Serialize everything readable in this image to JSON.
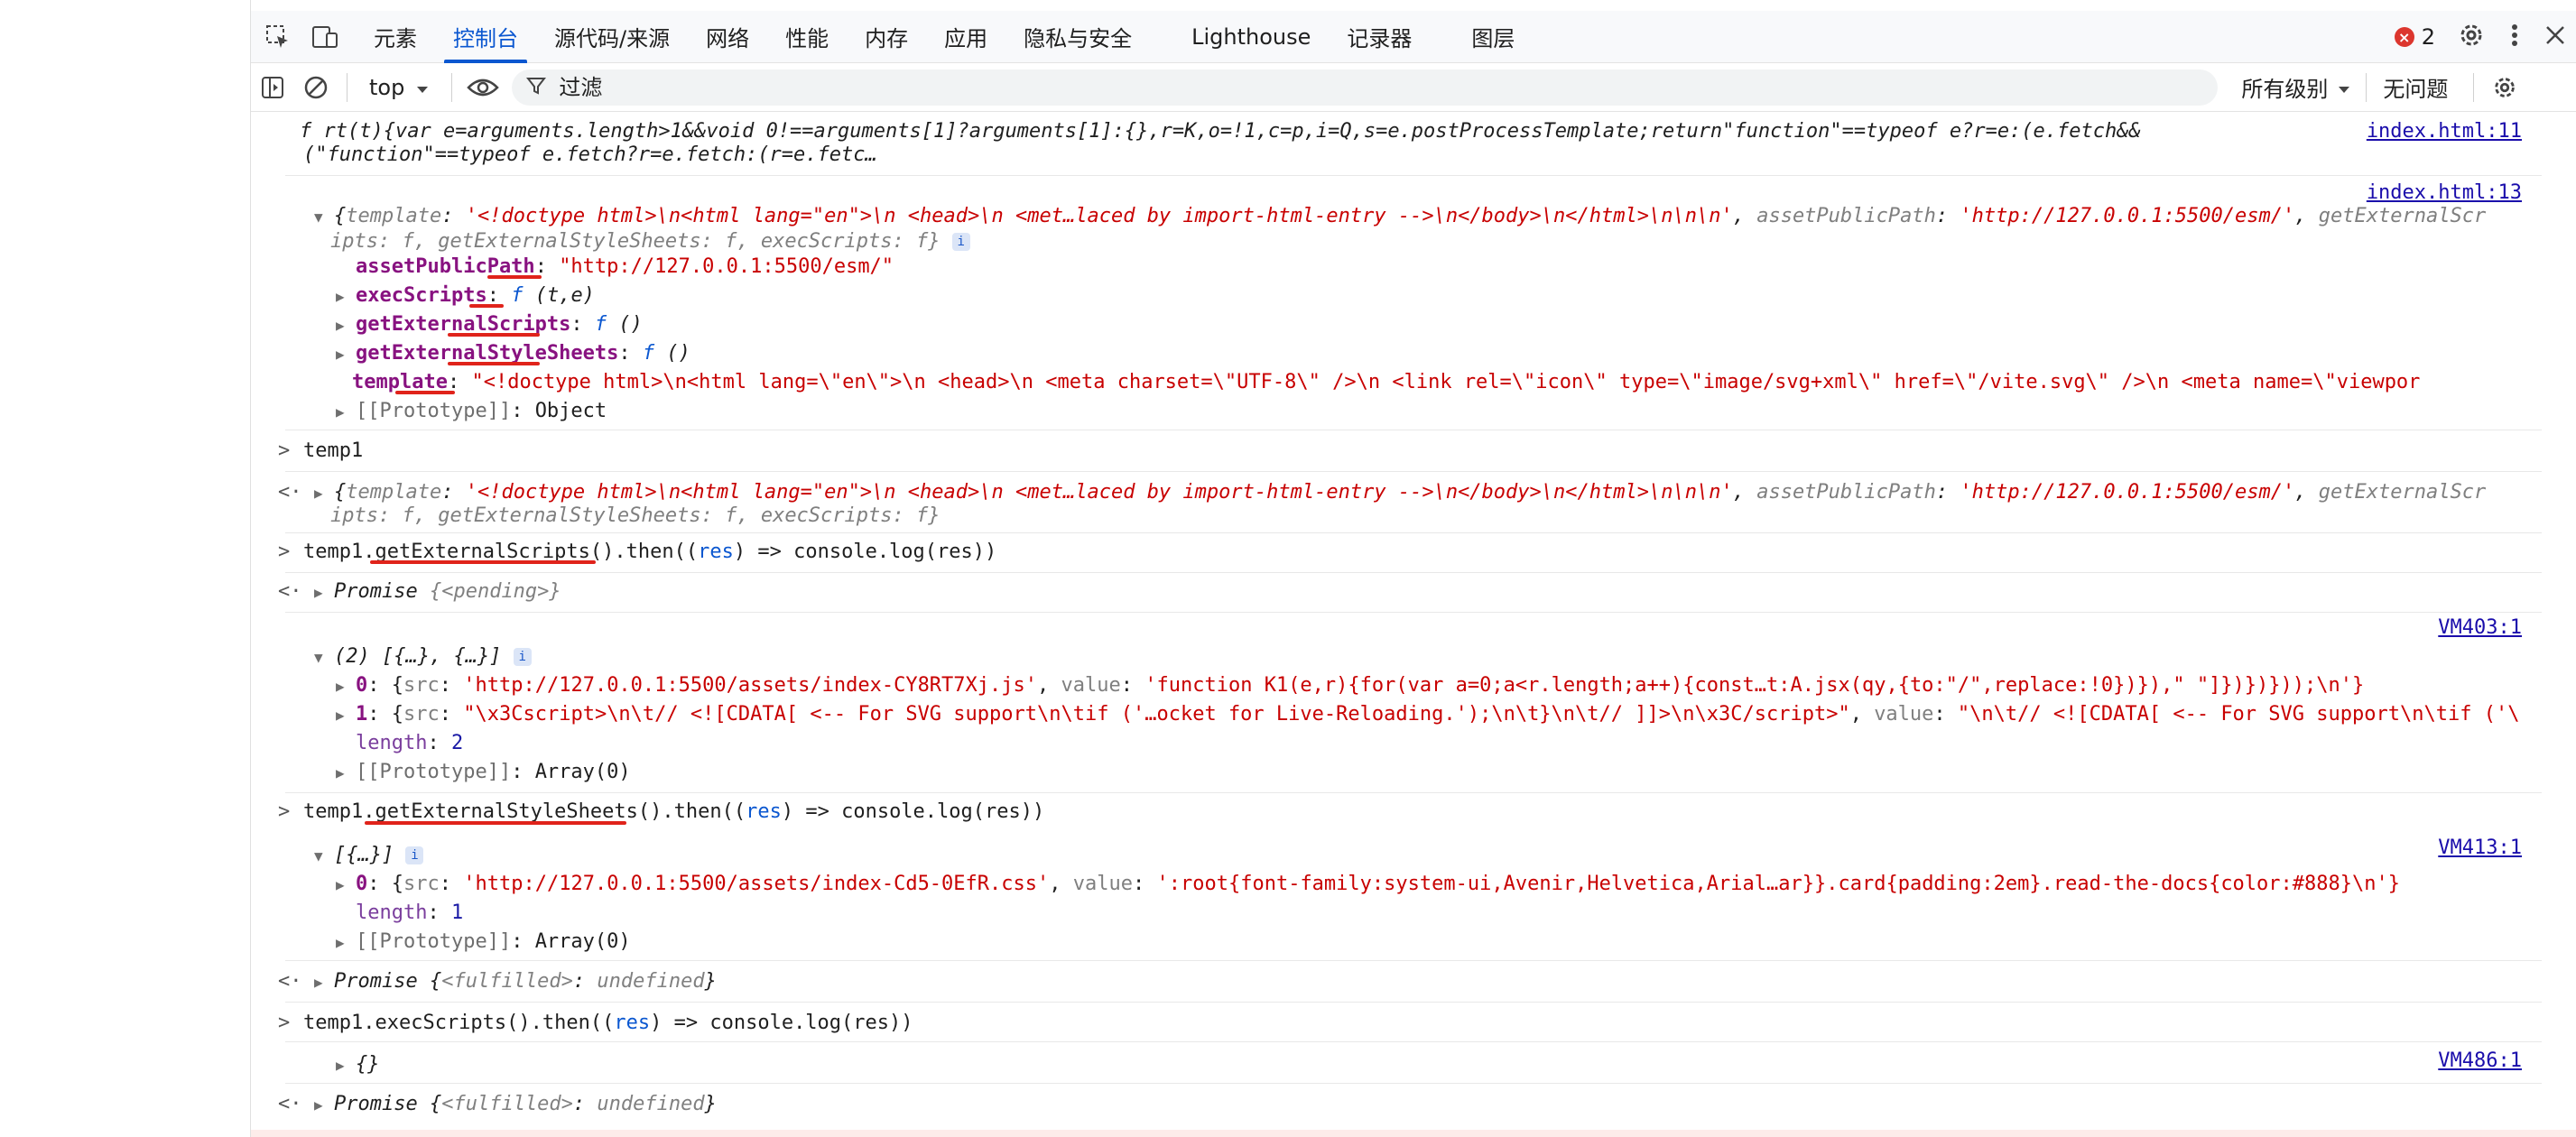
{
  "tabs": [
    {
      "label": "元素"
    },
    {
      "label": "控制台"
    },
    {
      "label": "源代码/来源"
    },
    {
      "label": "网络"
    },
    {
      "label": "性能"
    },
    {
      "label": "内存"
    },
    {
      "label": "应用"
    },
    {
      "label": "隐私与安全"
    },
    {
      "label": "Lighthouse"
    },
    {
      "label": "记录器"
    },
    {
      "label": "图层"
    }
  ],
  "active_tab": "控制台",
  "error_count": "2",
  "toolbar": {
    "context": "top",
    "filter_placeholder": "过滤",
    "levels": "所有级别",
    "issues": "无问题"
  },
  "icons": {
    "inspect": "inspect-element-icon",
    "device": "device-toolbar-icon",
    "settings": "gear-icon",
    "more": "more-vertical-icon",
    "close": "close-icon",
    "sidebar": "sidebar-toggle-icon",
    "clear": "clear-console-icon",
    "eye": "live-expression-icon",
    "filter": "filter-icon"
  },
  "colors": {
    "accent": "#0b57d0",
    "error": "#dc362e",
    "string": "#c80000",
    "key": "#881280",
    "underline": "#e0231b"
  },
  "messages": {
    "fn_line1": "rt(t){var e=arguments.length>1&&void 0!==arguments[1]?arguments[1]:{},r=K,o=!1,c=p,i=Q,s=e.postProcessTemplate;return\"function\"==typeof e?r=e:(e.fetch&&",
    "fn_line2": "(\"function\"==typeof e.fetch?r=e.fetch:(r=e.fetc…",
    "fn_src": "index.html:11",
    "obj_src": "index.html:13",
    "obj_template_val": "'<!doctype html>\\n<html lang=\"en\">\\n  <head>\\n    <met…laced by import-html-entry -->\\n</body>\\n</html>\\n\\n\\n'",
    "obj_asset_val": "'http://127.0.0.1:5500/esm/'",
    "obj_tail_key": "getExternalScr",
    "obj_line2": "ipts: f, getExternalStyleSheets: f, execScripts: f}",
    "prop_asset_key": "assetPublicPath",
    "prop_asset_val": "\"http://127.0.0.1:5500/esm/\"",
    "prop_exec_key": "execScripts",
    "prop_exec_val": "(t,e)",
    "prop_ges_key": "getExternalScripts",
    "prop_ges_val": "()",
    "prop_gess_key": "getExternalStyleSheets",
    "prop_gess_val": "()",
    "prop_template_key": "template",
    "prop_template_val": "\"<!doctype html>\\n<html lang=\\\"en\\\">\\n  <head>\\n    <meta charset=\\\"UTF-8\\\" />\\n    <link rel=\\\"icon\\\" type=\\\"image/svg+xml\\\" href=\\\"/vite.svg\\\" />\\n    <meta name=\\\"viewpor",
    "prototype_key": "[[Prototype]]",
    "prototype_obj": "Object",
    "cmd_temp1": "temp1",
    "cmd_ges_pre": "temp1.",
    "cmd_ges_fn": "getExternalScripts",
    "cmd_then_a": "().then((",
    "cmd_res": "res",
    "cmd_then_b": ") => console.log(res))",
    "promise_label": "Promise",
    "pending": "{<pending>}",
    "vm403": "VM403:1",
    "arr2_head": "(2) [{…}, {…}]",
    "arr2_0_key": "0",
    "arr2_0_src": "'http://127.0.0.1:5500/assets/index-CY8RT7Xj.js'",
    "arr2_0_value": "'function K1(e,r){for(var a=0;a<r.length;a++){const…t:A.jsx(qy,{to:\"/\",replace:!0})}),\" \"]})})}));\\n'}",
    "arr2_1_key": "1",
    "arr2_1_src": "\"\\x3Cscript>\\n\\t// <![CDATA[  <-- For SVG support\\n\\tif ('…ocket for Live-Reloading.');\\n\\t}\\n\\t// ]]>\\n\\x3C/script>\"",
    "arr2_1_value": "\"\\n\\t// <![CDATA[  <-- For SVG support\\n\\tif ('\\",
    "length_key": "length",
    "len2": "2",
    "len1": "1",
    "array0": "Array(0)",
    "cmd_gess_fn": "getExternalStyleSheets",
    "vm413": "VM413:1",
    "arr1_head": "[{…}]",
    "arr1_0_src": "'http://127.0.0.1:5500/assets/index-Cd5-0EfR.css'",
    "arr1_0_value": "':root{font-family:system-ui,Avenir,Helvetica,Arial…ar}}.card{padding:2em}.read-the-docs{color:#888}\\n'}",
    "fulfilled": "<fulfilled>",
    "undefined": "undefined",
    "cmd_exec_pre": "temp1.execScripts().then((",
    "empty_obj": "{}",
    "vm486": "VM486:1",
    "key_template": "template",
    "key_asset": "assetPublicPath",
    "key_src": "src",
    "key_value": "value",
    "f_char": "f"
  }
}
